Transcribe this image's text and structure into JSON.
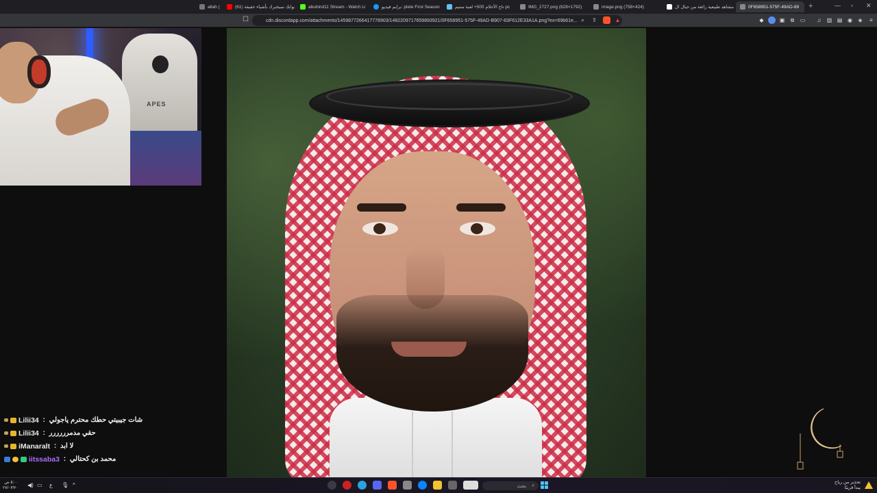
{
  "browser": {
    "tabs": [
      {
        "title": "allah (",
        "favicon_color": "#777777"
      },
      {
        "title": "(61) جوابك سيخبرك بأشياء حقيقة",
        "favicon_color": "#ff0000"
      },
      {
        "title": "abuhind11 Stream - Watch Li",
        "favicon_color": "#53fc18"
      },
      {
        "title": "برايم فيديو: plete First Season",
        "favicon_color": "#1a98ff"
      },
      {
        "title": "تاج الأحلام 500+ لعبة ستيم pc",
        "favicon_color": "#66c0f4"
      },
      {
        "title": "IMG_2727.png (828×1792)",
        "favicon_color": "#888888"
      },
      {
        "title": "image.png (758×424)",
        "favicon_color": "#888888"
      },
      {
        "title": "مشاهد طبيعية رائعة من جبال ال",
        "favicon_color": "#ffffff"
      },
      {
        "title": "0F658951-575F-49AD-89",
        "favicon_color": "#888888",
        "active": true
      }
    ],
    "url": "cdn.discordapp.com/attachments/1459877266417778903/1482209717659893921/0F658951-575F-49AD-B907-83F612E33A1A.png?ex=69b61e...",
    "window_controls": [
      "—",
      "▫",
      "✕"
    ]
  },
  "webcam": {
    "chair_brand": "APES"
  },
  "chat": {
    "messages": [
      {
        "user": "Lilii34",
        "message": "شات جيبيتي حطك محترم ياجولي",
        "badges": [
          "small",
          "gold"
        ],
        "user_color": "#eaeaea"
      },
      {
        "user": "Lilii34",
        "message": "حقي مدمرررررر",
        "badges": [
          "small",
          "gold"
        ],
        "user_color": "#eaeaea"
      },
      {
        "user": "iManaralt",
        "message": "لا ابد",
        "badges": [
          "small",
          "gold"
        ],
        "user_color": "#eaeaea"
      },
      {
        "user": "iitssaba3",
        "message": "محمد بن كحتالي",
        "badges": [
          "blue",
          "coin",
          "green"
        ],
        "user_color": "#a970ff"
      }
    ]
  },
  "taskbar": {
    "clock_time": "٥:٠٠ ص",
    "clock_date": "٢٧/٠٣/٢٠",
    "lang": "ع",
    "search_placeholder": "بحث",
    "weather_line1": "تحذير من رياح",
    "weather_line2": "يبدأ قريبًا"
  },
  "colors": {
    "accent": "#4cc2ff",
    "chat_purple": "#a970ff",
    "ghutra_red": "#cd2d46"
  }
}
